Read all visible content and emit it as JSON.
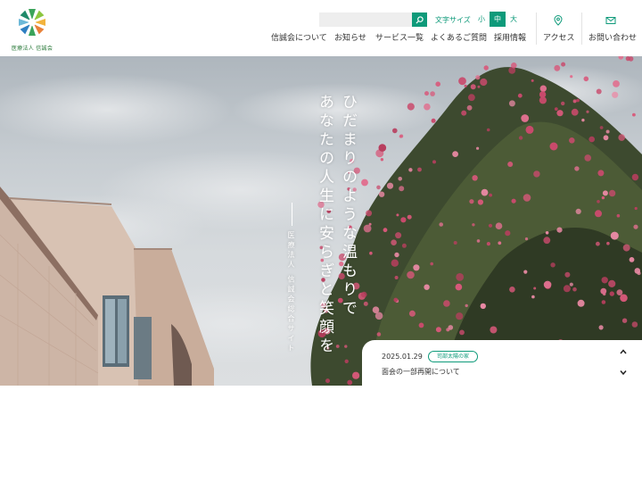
{
  "header": {
    "logo_text": "医療法人 信誠会",
    "search": {
      "placeholder": "",
      "value": ""
    },
    "fontsize": {
      "label": "文字サイズ",
      "small": "小",
      "medium": "中",
      "large": "大",
      "selected": "medium"
    },
    "nav": [
      {
        "label": "信誠会について"
      },
      {
        "label": "お知らせ"
      },
      {
        "label": "サービス一覧"
      },
      {
        "label": "よくあるご質問"
      },
      {
        "label": "採用情報"
      }
    ],
    "utility": {
      "access": "アクセス",
      "contact": "お問い合わせ"
    }
  },
  "hero": {
    "catch_line1": "ひだまりのような温もりで",
    "catch_line2": "あなたの人生に安らぎと笑顔を",
    "sub_catch": "医療法人 信誠会総合サイト"
  },
  "news": {
    "date": "2025.01.29",
    "category": "司部太陽の家",
    "title": "面会の一部再開について"
  },
  "colors": {
    "accent": "#0e9a7a",
    "logo_green": "#2a7a3a",
    "flower_pink": "#d8587a"
  }
}
